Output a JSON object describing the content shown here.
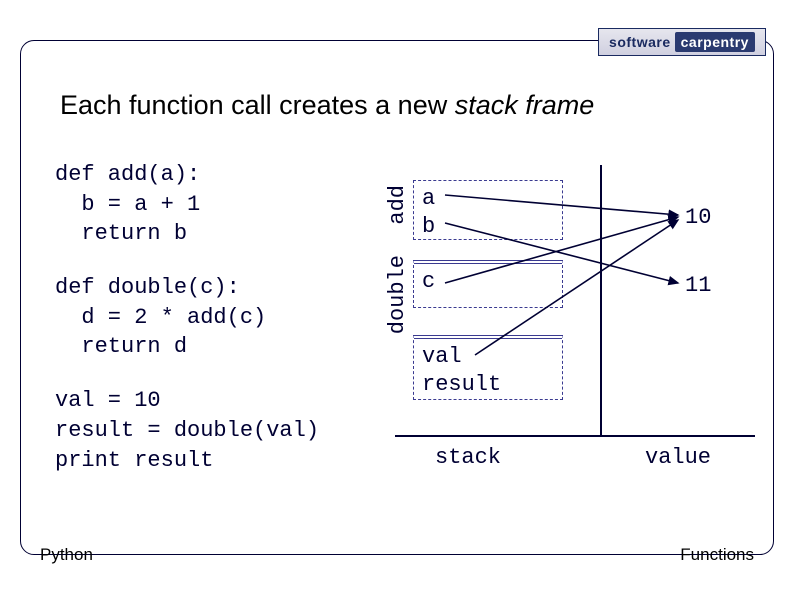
{
  "logo": {
    "word1": "software",
    "word2": "carpentry"
  },
  "title": {
    "prefix": "Each function call creates a new ",
    "emph": "stack frame"
  },
  "code": {
    "block1": "def add(a):\n  b = a + 1\n  return b",
    "block2": "def double(c):\n  d = 2 * add(c)\n  return d",
    "block3": "val = 10\nresult = double(val)\nprint result"
  },
  "labels": {
    "vertical_add": "add",
    "vertical_double": "double",
    "frame_add_line1": "a",
    "frame_add_line2": "b",
    "frame_double_line1": "c",
    "frame_global_line1": "val",
    "frame_global_line2": "result",
    "value_10": "10",
    "value_11": "11",
    "axis_stack": "stack",
    "axis_value": "value"
  },
  "footer": {
    "left": "Python",
    "right": "Functions"
  }
}
